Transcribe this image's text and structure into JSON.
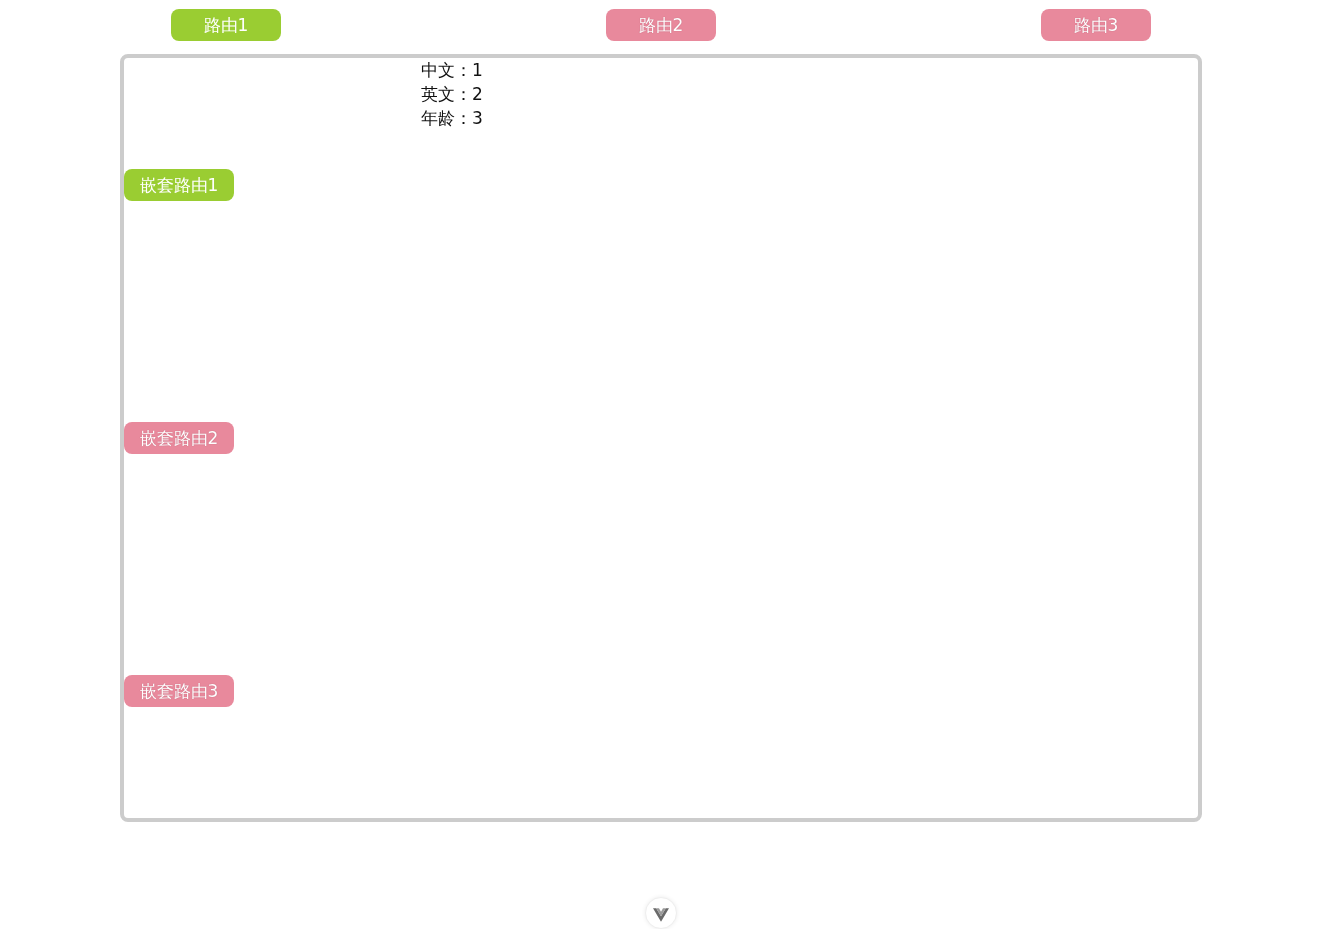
{
  "top_nav": [
    {
      "label": "路由1",
      "selected": true
    },
    {
      "label": "路由2",
      "selected": false
    },
    {
      "label": "路由3",
      "selected": false
    }
  ],
  "panel": {
    "nested_nav": [
      {
        "label": "嵌套路由1",
        "selected": true
      },
      {
        "label": "嵌套路由2",
        "selected": false
      },
      {
        "label": "嵌套路由3",
        "selected": false
      }
    ],
    "details": [
      "中文：1",
      "英文：2",
      "年龄：3"
    ]
  }
}
